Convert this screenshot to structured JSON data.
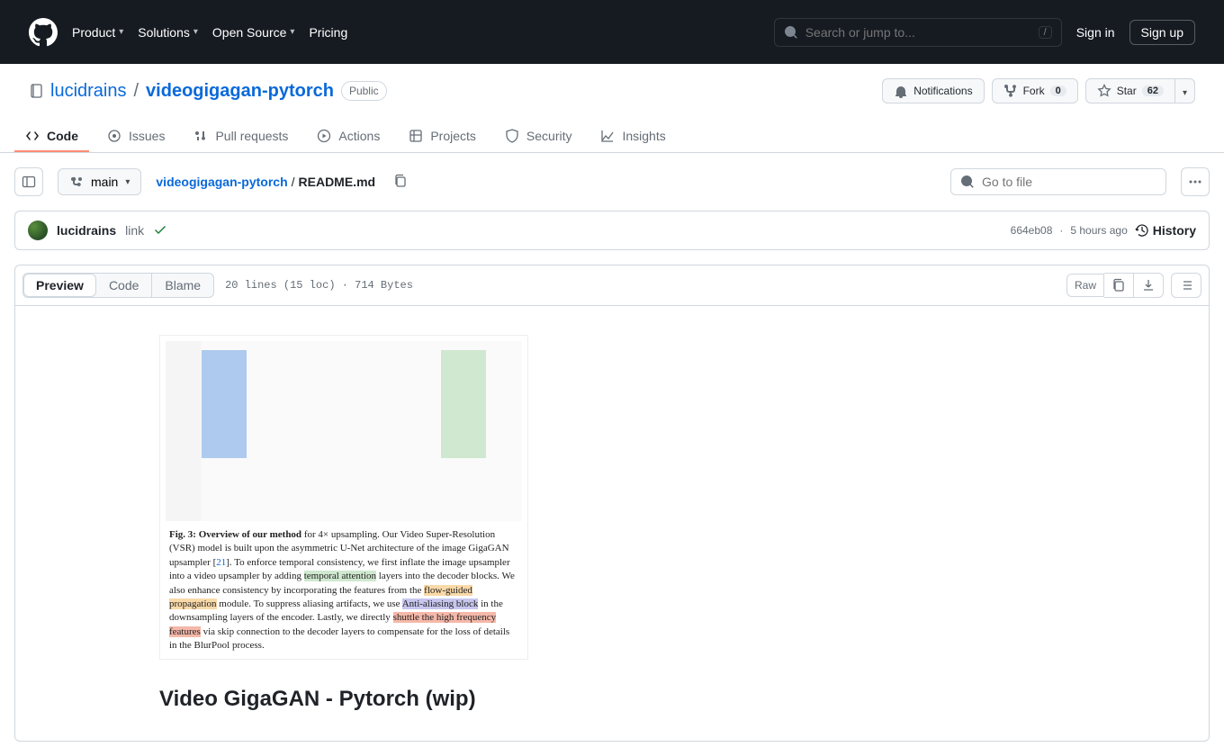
{
  "header": {
    "nav": [
      "Product",
      "Solutions",
      "Open Source",
      "Pricing"
    ],
    "search_placeholder": "Search or jump to...",
    "slash": "/",
    "sign_in": "Sign in",
    "sign_up": "Sign up"
  },
  "repo": {
    "owner": "lucidrains",
    "name": "videogigagan-pytorch",
    "visibility": "Public",
    "notifications": "Notifications",
    "fork_label": "Fork",
    "fork_count": "0",
    "star_label": "Star",
    "star_count": "62"
  },
  "tabs": [
    "Code",
    "Issues",
    "Pull requests",
    "Actions",
    "Projects",
    "Security",
    "Insights"
  ],
  "file_bar": {
    "branch": "main",
    "crumb_repo": "videogigagan-pytorch",
    "crumb_file": "README.md",
    "go_to_file": "Go to file"
  },
  "commit": {
    "author": "lucidrains",
    "message": "link",
    "sha": "664eb08",
    "time": "5 hours ago",
    "history": "History"
  },
  "viewer": {
    "preview": "Preview",
    "code": "Code",
    "blame": "Blame",
    "info": "20 lines (15 loc) · 714 Bytes",
    "raw": "Raw"
  },
  "readme": {
    "fig_lead": "Fig. 3: Overview of our method",
    "fig_text1": " for 4× upsampling. Our Video Super-Resolution (VSR) model is built upon the asymmetric U-Net architecture of the image GigaGAN upsampler [",
    "fig_cite": "21",
    "fig_text2": "]. To enforce temporal consistency, we first inflate the image upsampler into a video upsampler by adding ",
    "hl_ta": "temporal attention",
    "fig_text3": " layers into the decoder blocks. We also enhance consistency by incorporating the features from the ",
    "hl_fg": "flow-guided propagation",
    "fig_text4": " module. To suppress aliasing artifacts, we use ",
    "hl_aa": "Anti-aliasing block",
    "fig_text5": " in the downsampling layers of the encoder. Lastly, we directly ",
    "hl_hf": "shuttle the high frequency features",
    "fig_text6": " via skip connection to the decoder layers to compensate for the loss of details in the BlurPool process.",
    "h2": "Video GigaGAN - Pytorch (wip)"
  }
}
